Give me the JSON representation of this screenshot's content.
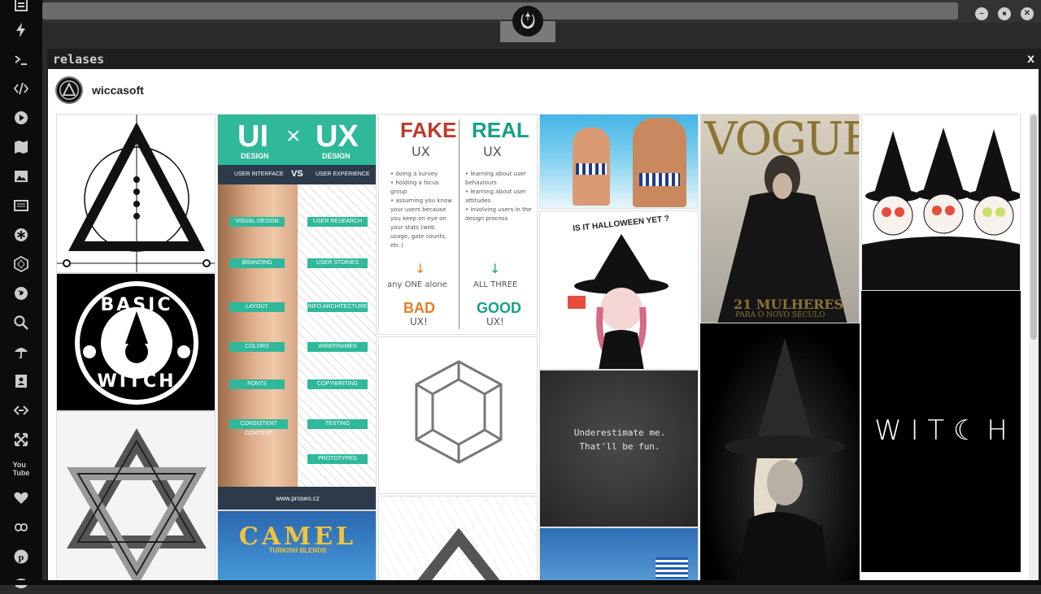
{
  "panel": {
    "title": "relases",
    "close": "x"
  },
  "profile": {
    "name": "wiccasoft"
  },
  "sidebar": {
    "icons": [
      "menu-icon",
      "lightning-icon",
      "terminal-icon",
      "code-icon",
      "play-icon",
      "map-icon",
      "image-icon",
      "news-icon",
      "asterisk-icon",
      "hexagon-icon",
      "globe-icon",
      "search-icon",
      "umbrella-icon",
      "contacts-icon",
      "link-icon",
      "expand-icon",
      "youtube-icon",
      "heart-icon",
      "infinity-icon",
      "pinterest-icon",
      "chat-icon"
    ]
  },
  "windows": {
    "minimize": "–",
    "maximize": "■",
    "close": "✕"
  },
  "pins": {
    "uiux": {
      "ui": "UI",
      "x": "×",
      "ux": "UX",
      "design": "DESIGN",
      "ui_sub": "USER INTERFACE",
      "vs": "VS",
      "ux_sub": "USER EXPERIENCE",
      "left": [
        "VISUAL DESIGN",
        "BRANDING",
        "LAYOUT",
        "COLORS",
        "FONTS",
        "CONSISTENT CONTENT"
      ],
      "right": [
        "USER RESEARCH",
        "USER STORIES",
        "INFO ARCHITECTURE",
        "WIREFRAMES",
        "COPYWRITING",
        "TESTING",
        "PROTOTYPES"
      ],
      "footer": "www.proseo.cz"
    },
    "fakereal": {
      "fake": "FAKE",
      "real": "REAL",
      "ux": "UX",
      "left_list": [
        "• doing a survey",
        "• holding a focus group",
        "• assuming you know your users because you keep on eye on your stats (web usage, gate counts, etc.)"
      ],
      "right_list": [
        "• learning about user behaviours",
        "• learning about user attitudes",
        "• involving users in the design process"
      ],
      "any_one": "any ONE alone",
      "all_three": "ALL THREE",
      "bad": "BAD",
      "good": "GOOD",
      "ux_end": "UX!"
    },
    "starbucks": {
      "top": "BASIC",
      "bottom": "WITCH"
    },
    "halloween": {
      "text": "IS IT HALLOWEEN YET ?"
    },
    "quote": {
      "line1": "Underestimate me.",
      "line2": "That'll be fun."
    },
    "vogue": {
      "title": "VOGUE",
      "cover": "21 MULHERES",
      "cover_sub": "PARA O NOVO SÉCULO"
    },
    "witch": {
      "text": "W I T ☾ H"
    },
    "camel": {
      "title": "CAMEL",
      "sub": "TURKISH BLENDS"
    }
  }
}
